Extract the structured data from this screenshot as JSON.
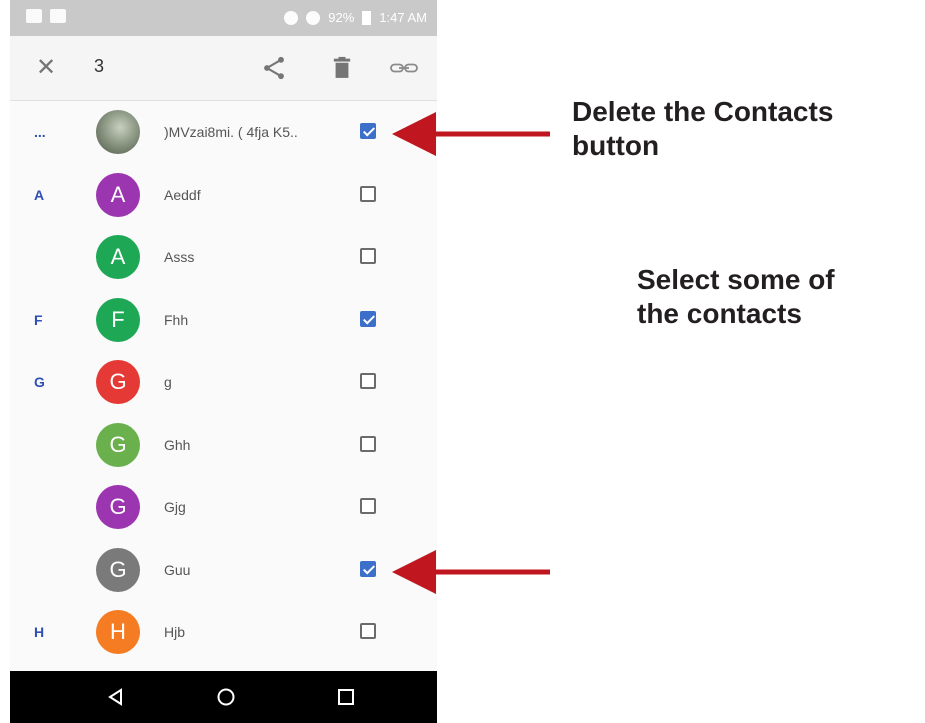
{
  "status_bar": {
    "battery_text": "92%",
    "time": "1:47 AM"
  },
  "toolbar": {
    "selected_count": "3"
  },
  "contacts": [
    {
      "letter": "...",
      "avatar_letter": "",
      "avatar_color": "#8c9a84",
      "name": ")MVzai8mi. ( 4fja K5..",
      "checked": true
    },
    {
      "letter": "A",
      "avatar_letter": "A",
      "avatar_color": "#9c35b0",
      "name": "Aeddf",
      "checked": false
    },
    {
      "letter": "",
      "avatar_letter": "A",
      "avatar_color": "#1ea856",
      "name": "Asss",
      "checked": false
    },
    {
      "letter": "F",
      "avatar_letter": "F",
      "avatar_color": "#1ea856",
      "name": "Fhh",
      "checked": true
    },
    {
      "letter": "G",
      "avatar_letter": "G",
      "avatar_color": "#e53935",
      "name": "g",
      "checked": false
    },
    {
      "letter": "",
      "avatar_letter": "G",
      "avatar_color": "#6ab04c",
      "name": "Ghh",
      "checked": false
    },
    {
      "letter": "",
      "avatar_letter": "G",
      "avatar_color": "#9c35b0",
      "name": "Gjg",
      "checked": false
    },
    {
      "letter": "",
      "avatar_letter": "G",
      "avatar_color": "#7a7a7a",
      "name": "Guu",
      "checked": true
    },
    {
      "letter": "H",
      "avatar_letter": "H",
      "avatar_color": "#f57c22",
      "name": "Hjb",
      "checked": false
    }
  ],
  "annotations": {
    "delete_line1": "Delete the Contacts",
    "delete_line2": "button",
    "select_line1": "Select some of",
    "select_line2": "the contacts"
  },
  "colors": {
    "accent": "#3b6fc9",
    "arrow": "#c0161f",
    "section_letter": "#2e4fb5"
  }
}
